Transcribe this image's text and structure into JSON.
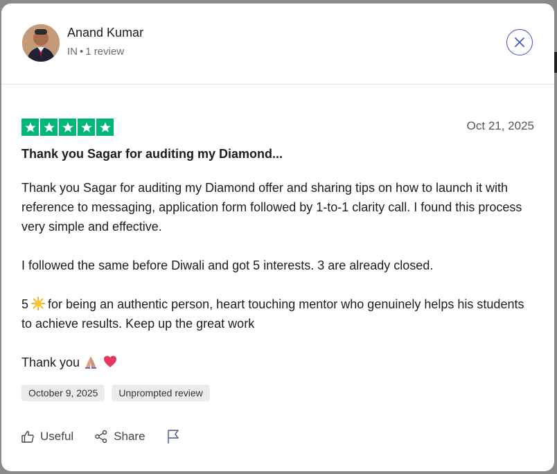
{
  "reviewer": {
    "name": "Anand Kumar",
    "country": "IN",
    "review_count": "1 review"
  },
  "review": {
    "rating": 5,
    "date": "Oct 21, 2025",
    "title": "Thank you Sagar for auditing my Diamond...",
    "paragraphs": [
      "Thank you Sagar for auditing my Diamond offer and sharing tips on how to launch it with reference to messaging, application form followed by 1-to-1 clarity call. I found this process very simple and effective.",
      "I followed the same before Diwali and got 5 interests. 3 are already closed.",
      "for being an authentic person, heart touching mentor who genuinely helps his students to achieve results. Keep up the great work",
      "Thank you"
    ],
    "p3_prefix": "5",
    "tags": [
      "October 9, 2025",
      "Unprompted review"
    ]
  },
  "actions": {
    "useful": "Useful",
    "share": "Share"
  },
  "colors": {
    "star_green": "#00b67a",
    "close_blue": "#3b4fc4"
  },
  "icons": [
    "close-icon",
    "star-icon",
    "sun-emoji-icon",
    "pray-emoji-icon",
    "heart-emoji-icon",
    "thumbs-up-icon",
    "share-icon",
    "flag-icon"
  ]
}
